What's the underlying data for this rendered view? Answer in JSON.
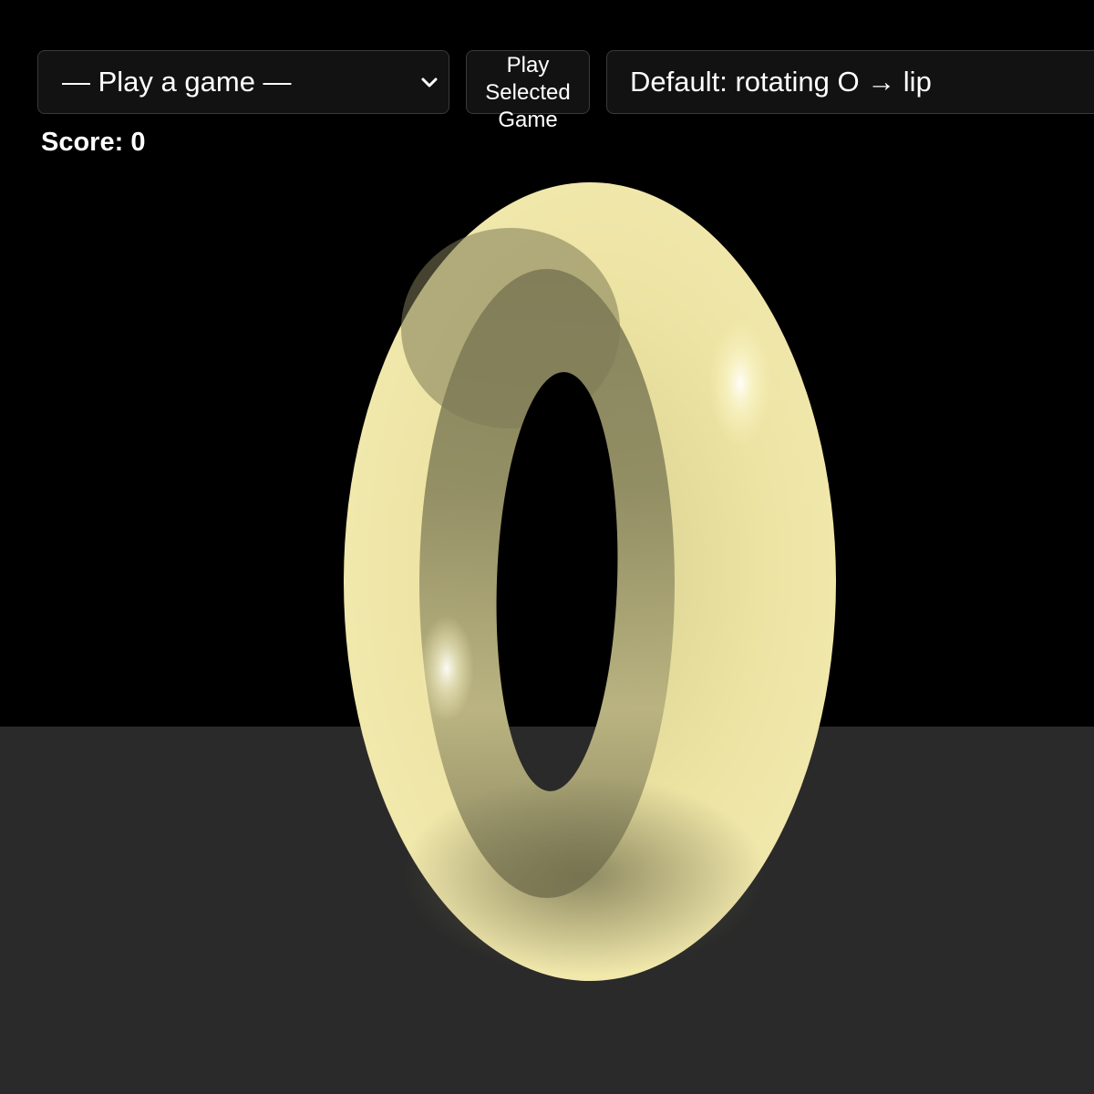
{
  "controls": {
    "game_select_value": "— Play a game —",
    "play_button_label": "Play\nSelected\nGame",
    "prompt_text": "Default: rotating O → lip"
  },
  "hud": {
    "score_text": "Score: 0"
  },
  "icons": {
    "select_arrow": "chevron-down-icon"
  },
  "scene": {
    "object": "torus",
    "colors": {
      "background": "#000000",
      "floor": "#2a2a2a",
      "torus_base": "#eee5a0",
      "ui_panel": "#121212",
      "ui_border": "#3a3a3a",
      "text": "#ffffff"
    }
  }
}
